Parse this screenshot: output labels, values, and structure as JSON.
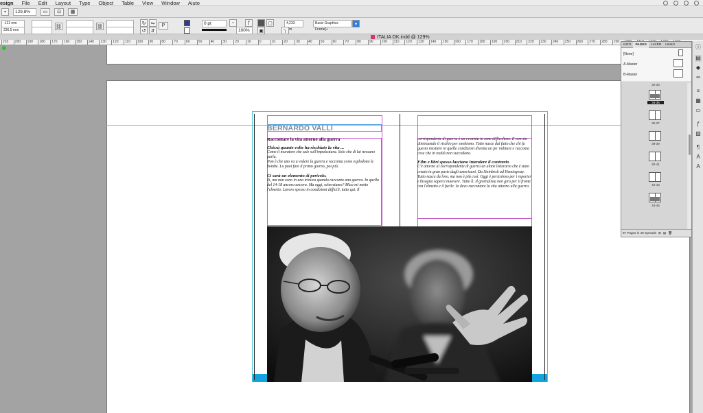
{
  "menubar": {
    "app_name": "esign",
    "items": [
      "File",
      "Edit",
      "Layout",
      "Type",
      "Object",
      "Table",
      "View",
      "Window",
      "Aiuto"
    ]
  },
  "appbar": {
    "zoom": "129,8%"
  },
  "control": {
    "x": "-121 mm",
    "y": "236,5 mm",
    "stroke_weight": "0 pt",
    "opacity": "100%",
    "fitting_value": "4,233 mm",
    "object_style": "Basic Graphics Frame]+"
  },
  "document": {
    "title": "ITALIA OK.indd @ 129%"
  },
  "ruler": {
    "ticks": [
      "210",
      "200",
      "190",
      "180",
      "170",
      "160",
      "150",
      "140",
      "130",
      "120",
      "110",
      "100",
      "90",
      "80",
      "70",
      "60",
      "50",
      "40",
      "30",
      "20",
      "10",
      "0",
      "10",
      "20",
      "30",
      "40",
      "50",
      "60",
      "70",
      "80",
      "90",
      "100",
      "110",
      "120",
      "130",
      "140",
      "150",
      "160",
      "170",
      "180",
      "190",
      "200",
      "210",
      "220",
      "230",
      "240",
      "250",
      "260",
      "270",
      "280",
      "290",
      "300",
      "310",
      "320",
      "330",
      "340"
    ]
  },
  "spread": {
    "author": "BERNARDO VALLI",
    "left_column": {
      "title": "Raccontare la vita attorno alla guerra",
      "sections": [
        {
          "heading": "Chissà quante volte ha rischiato la vita ...",
          "body": "Come il muratore che sale sull'impalcatura. Solo che di lui nessuno parla.\nNon è che uno va a vedere la guerra e racconta come esplodono le bombe. Lo puoi fare il primo giorno, poi più."
        },
        {
          "heading": "Ci sarà un elemento di pericolo.",
          "body": "Sì, ma non sono in una trincea quando racconto una guerra. In quella del 14-18 ancora ancora. Ma oggi, scherziamo? Mica mi metto l'elmetto. Lavoro spesso in condizioni difficili, tutto qui. Il"
        }
      ]
    },
    "right_column": {
      "intro": "corrispondente di guerra è un cronista in zone difficoltose. E non sto diminuendo il rischio per snobismo. Tutto nasce dal fatto che chi fa questo mestiere in quelle condizioni diventa un po' militare e racconta cose che in realtà non succedono.",
      "heading": "Film e libri spesso lasciano intendere il contrario",
      "body": "C'è attorno al corrispondente di guerra un alone letterario che è stato creato in gran parte dagli americani. Da Steinbeck ad Hemingway. Tutto nasce da loro, ma non è più così. Oggi è pericoloso per i reporter e bisogna saperci muovere. Tutto lì. Il giornalista non gira per il fronte con l'elmetto e il fucile. Io devo raccontare la vita attorno alla guerra."
    }
  },
  "pages_panel": {
    "tabs": [
      "INFO",
      "PAGES",
      "LAYER",
      "LINKS"
    ],
    "masters": [
      "[None]",
      "A-Master",
      "B-Master"
    ],
    "spreads": [
      "32-33",
      "34-35",
      "36-37",
      "38-39",
      "40-41",
      "42-43",
      "44-45"
    ],
    "selected_spread": "34-35",
    "footer": "97 Pages in 49 Spreads"
  },
  "colors": {
    "bleed": "#14a3dd",
    "guide": "#46c8e0",
    "margin": "#c35ac8",
    "pasteboard": "#a3a3a3"
  }
}
